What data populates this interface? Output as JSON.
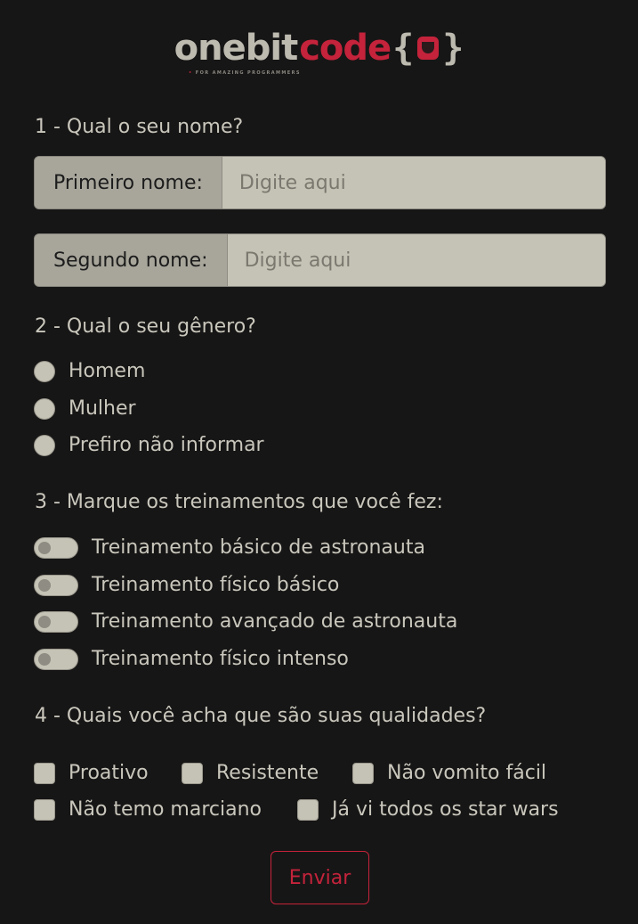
{
  "logo": {
    "word_one": "onebit",
    "word_two": "code",
    "brace_open": "{",
    "brace_close": "}",
    "tagline": "FOR AMAZING PROGRAMMERS",
    "icon": "rock-hand-icon"
  },
  "questions": {
    "q1": "1 - Qual o seu nome?",
    "q2": "2 - Qual o seu gênero?",
    "q3": "3 - Marque os treinamentos que você fez:",
    "q4": "4 - Quais você acha que são suas qualidades?"
  },
  "name_fields": [
    {
      "label": "Primeiro nome:",
      "value": "",
      "placeholder": "Digite aqui"
    },
    {
      "label": "Segundo nome:",
      "value": "",
      "placeholder": "Digite aqui"
    }
  ],
  "gender_options": [
    {
      "label": "Homem",
      "checked": false
    },
    {
      "label": "Mulher",
      "checked": false
    },
    {
      "label": "Prefiro não informar",
      "checked": false
    }
  ],
  "trainings": [
    {
      "label": "Treinamento básico de astronauta",
      "on": false
    },
    {
      "label": "Treinamento físico básico",
      "on": false
    },
    {
      "label": "Treinamento avançado de astronauta",
      "on": false
    },
    {
      "label": "Treinamento físico intenso",
      "on": false
    }
  ],
  "qualities": [
    {
      "label": "Proativo",
      "checked": false
    },
    {
      "label": "Resistente",
      "checked": false
    },
    {
      "label": "Não vomito fácil",
      "checked": false
    },
    {
      "label": "Não temo marciano",
      "checked": false
    },
    {
      "label": "Já vi todos os star wars",
      "checked": false
    }
  ],
  "submit_label": "Enviar",
  "colors": {
    "background": "#171616",
    "accent": "#c4233b",
    "field": "#c5c3b5",
    "text": "#c9c7bc"
  }
}
